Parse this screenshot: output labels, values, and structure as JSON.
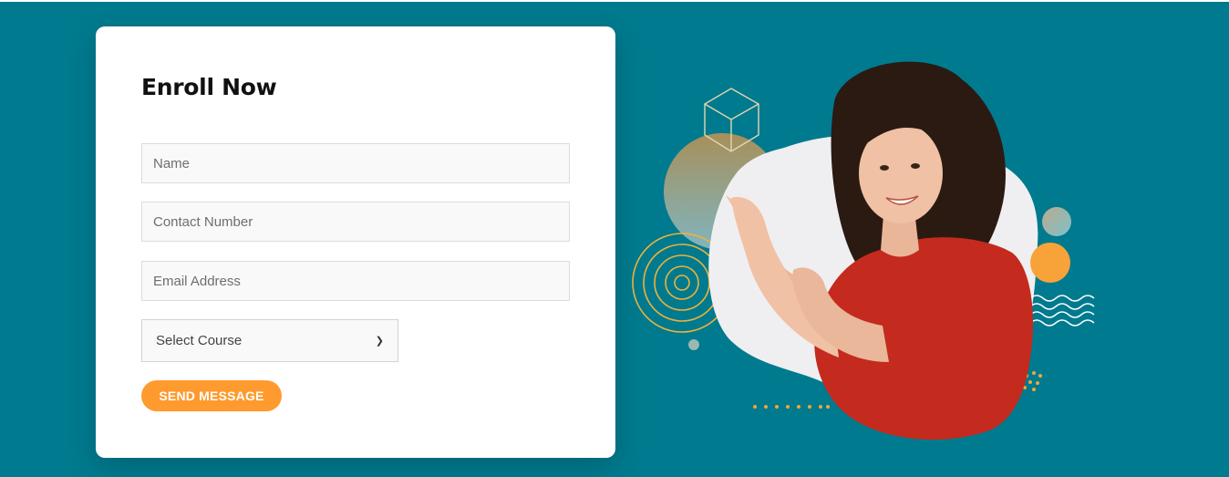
{
  "form": {
    "title": "Enroll Now",
    "name_placeholder": "Name",
    "contact_placeholder": "Contact Number",
    "email_placeholder": "Email Address",
    "course_select": {
      "selected": "Select Course"
    },
    "submit_label": "SEND MESSAGE"
  },
  "hero_image": {
    "description_icon": "woman-pointing-illustration"
  },
  "colors": {
    "background": "#007a8e",
    "accent": "#ff9a2e",
    "card": "#ffffff",
    "shirt": "#c42a1e"
  }
}
